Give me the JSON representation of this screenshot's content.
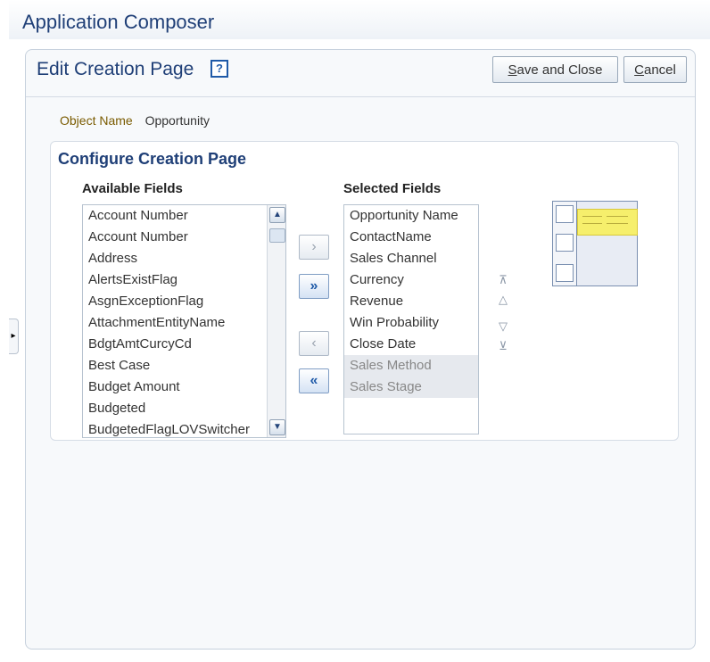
{
  "app": {
    "title": "Application Composer"
  },
  "page": {
    "title": "Edit Creation Page",
    "help_icon": "?",
    "save_and_close": {
      "mnemonic": "S",
      "rest": "ave and Close"
    },
    "cancel": {
      "mnemonic": "C",
      "rest": "ancel"
    }
  },
  "object": {
    "label": "Object Name",
    "value": "Opportunity"
  },
  "configure": {
    "title": "Configure Creation Page",
    "available_label": "Available Fields",
    "selected_label": "Selected Fields",
    "available": [
      "Account Number",
      "Account Number",
      "Address",
      "AlertsExistFlag",
      "AsgnExceptionFlag",
      "AttachmentEntityName",
      "BdgtAmtCurcyCd",
      "Best Case",
      "Budget Amount",
      "Budgeted",
      "BudgetedFlagLOVSwitcher"
    ],
    "selected": [
      "Opportunity Name",
      "ContactName",
      "Sales Channel",
      "Currency",
      "Revenue",
      "Win Probability",
      "Close Date",
      "Sales Method",
      "Sales Stage"
    ]
  },
  "icons": {
    "move": "›",
    "move_all": "»",
    "remove": "‹",
    "remove_all": "«",
    "scroll_up": "▲",
    "scroll_down": "▼",
    "reorder_top": "⊼",
    "reorder_up": "△",
    "reorder_down": "▽",
    "reorder_bottom": "⊻",
    "collapse_tab": "▸"
  },
  "colors": {
    "accent": "#1f3f77",
    "help": "#1f5aa8",
    "label": "#7a5b00",
    "preview_highlight": "#f6ef6c"
  }
}
